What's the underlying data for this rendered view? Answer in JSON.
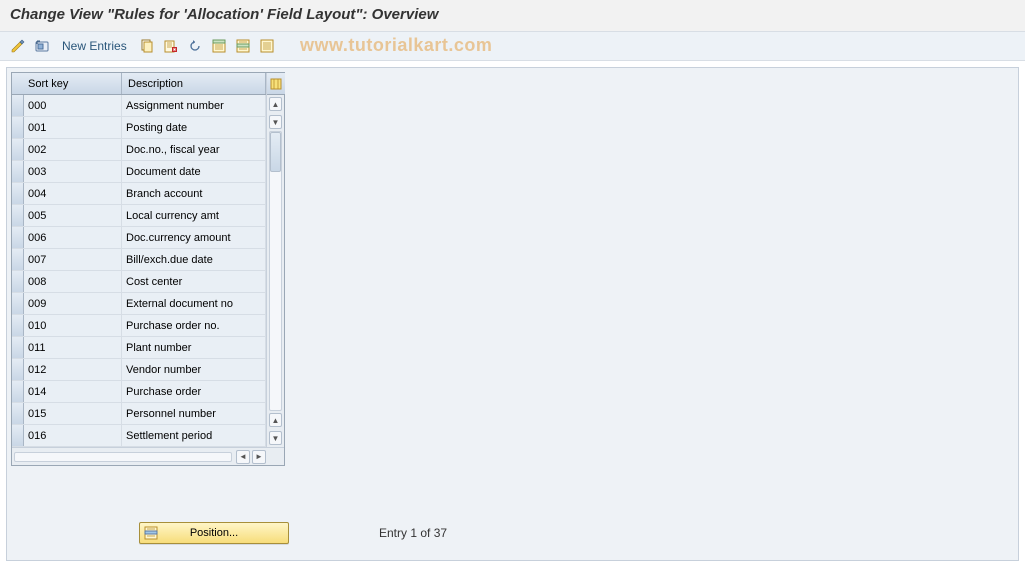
{
  "title": "Change View \"Rules for 'Allocation' Field Layout\": Overview",
  "watermark": "www.tutorialkart.com",
  "toolbar": {
    "new_entries_label": "New Entries"
  },
  "table": {
    "headers": {
      "key": "Sort key",
      "desc": "Description"
    },
    "rows": [
      {
        "key": "000",
        "desc": "Assignment number"
      },
      {
        "key": "001",
        "desc": "Posting date"
      },
      {
        "key": "002",
        "desc": "Doc.no., fiscal year"
      },
      {
        "key": "003",
        "desc": "Document date"
      },
      {
        "key": "004",
        "desc": "Branch account"
      },
      {
        "key": "005",
        "desc": "Local currency amt"
      },
      {
        "key": "006",
        "desc": "Doc.currency amount"
      },
      {
        "key": "007",
        "desc": "Bill/exch.due date"
      },
      {
        "key": "008",
        "desc": "Cost center"
      },
      {
        "key": "009",
        "desc": "External document no"
      },
      {
        "key": "010",
        "desc": "Purchase order no."
      },
      {
        "key": "011",
        "desc": "Plant number"
      },
      {
        "key": "012",
        "desc": "Vendor number"
      },
      {
        "key": "014",
        "desc": "Purchase order"
      },
      {
        "key": "015",
        "desc": "Personnel number"
      },
      {
        "key": "016",
        "desc": "Settlement period"
      }
    ]
  },
  "footer": {
    "position_label": "Position...",
    "entry_text": "Entry 1 of 37"
  }
}
